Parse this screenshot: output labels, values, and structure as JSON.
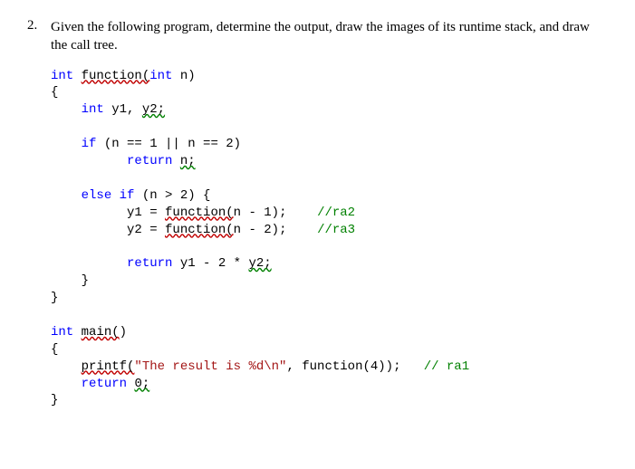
{
  "question": {
    "number": "2.",
    "text": "Given the following program, determine the output, draw the images of its runtime stack, and draw the call tree."
  },
  "code": {
    "l1_kw1": "int",
    "l1_fn": "function(",
    "l1_kw2": "int",
    "l1_rest": " n)",
    "l2": "{",
    "l3_kw": "int",
    "l3_rest": " y1, ",
    "l3_err": "y2;",
    "l5_kw": "if",
    "l5_rest": " (n == 1 || n == 2)",
    "l6_kw": "return",
    "l6_err": "n;",
    "l8_kw1": "else",
    "l8_kw2": "if",
    "l8_rest": " (n > 2) {",
    "l9_a": "y1 = ",
    "l9_u": "function(",
    "l9_b": "n - 1);",
    "l9_com": "//ra2",
    "l10_a": "y2 = ",
    "l10_u": "function(",
    "l10_b": "n - 2);",
    "l10_com": "//ra3",
    "l12_kw": "return",
    "l12_a": " y1 - 2 * ",
    "l12_err": "y2;",
    "l13": "}",
    "l14": "}",
    "l16_kw": "int",
    "l16_u": "main(",
    "l16_b": ")",
    "l17": "{",
    "l18_u": "printf(",
    "l18_str": "\"The result is %d\\n\"",
    "l18_b": ", function(4));",
    "l18_com": "// ra1",
    "l19_kw": "return",
    "l19_err": "0;",
    "l20": "}"
  }
}
